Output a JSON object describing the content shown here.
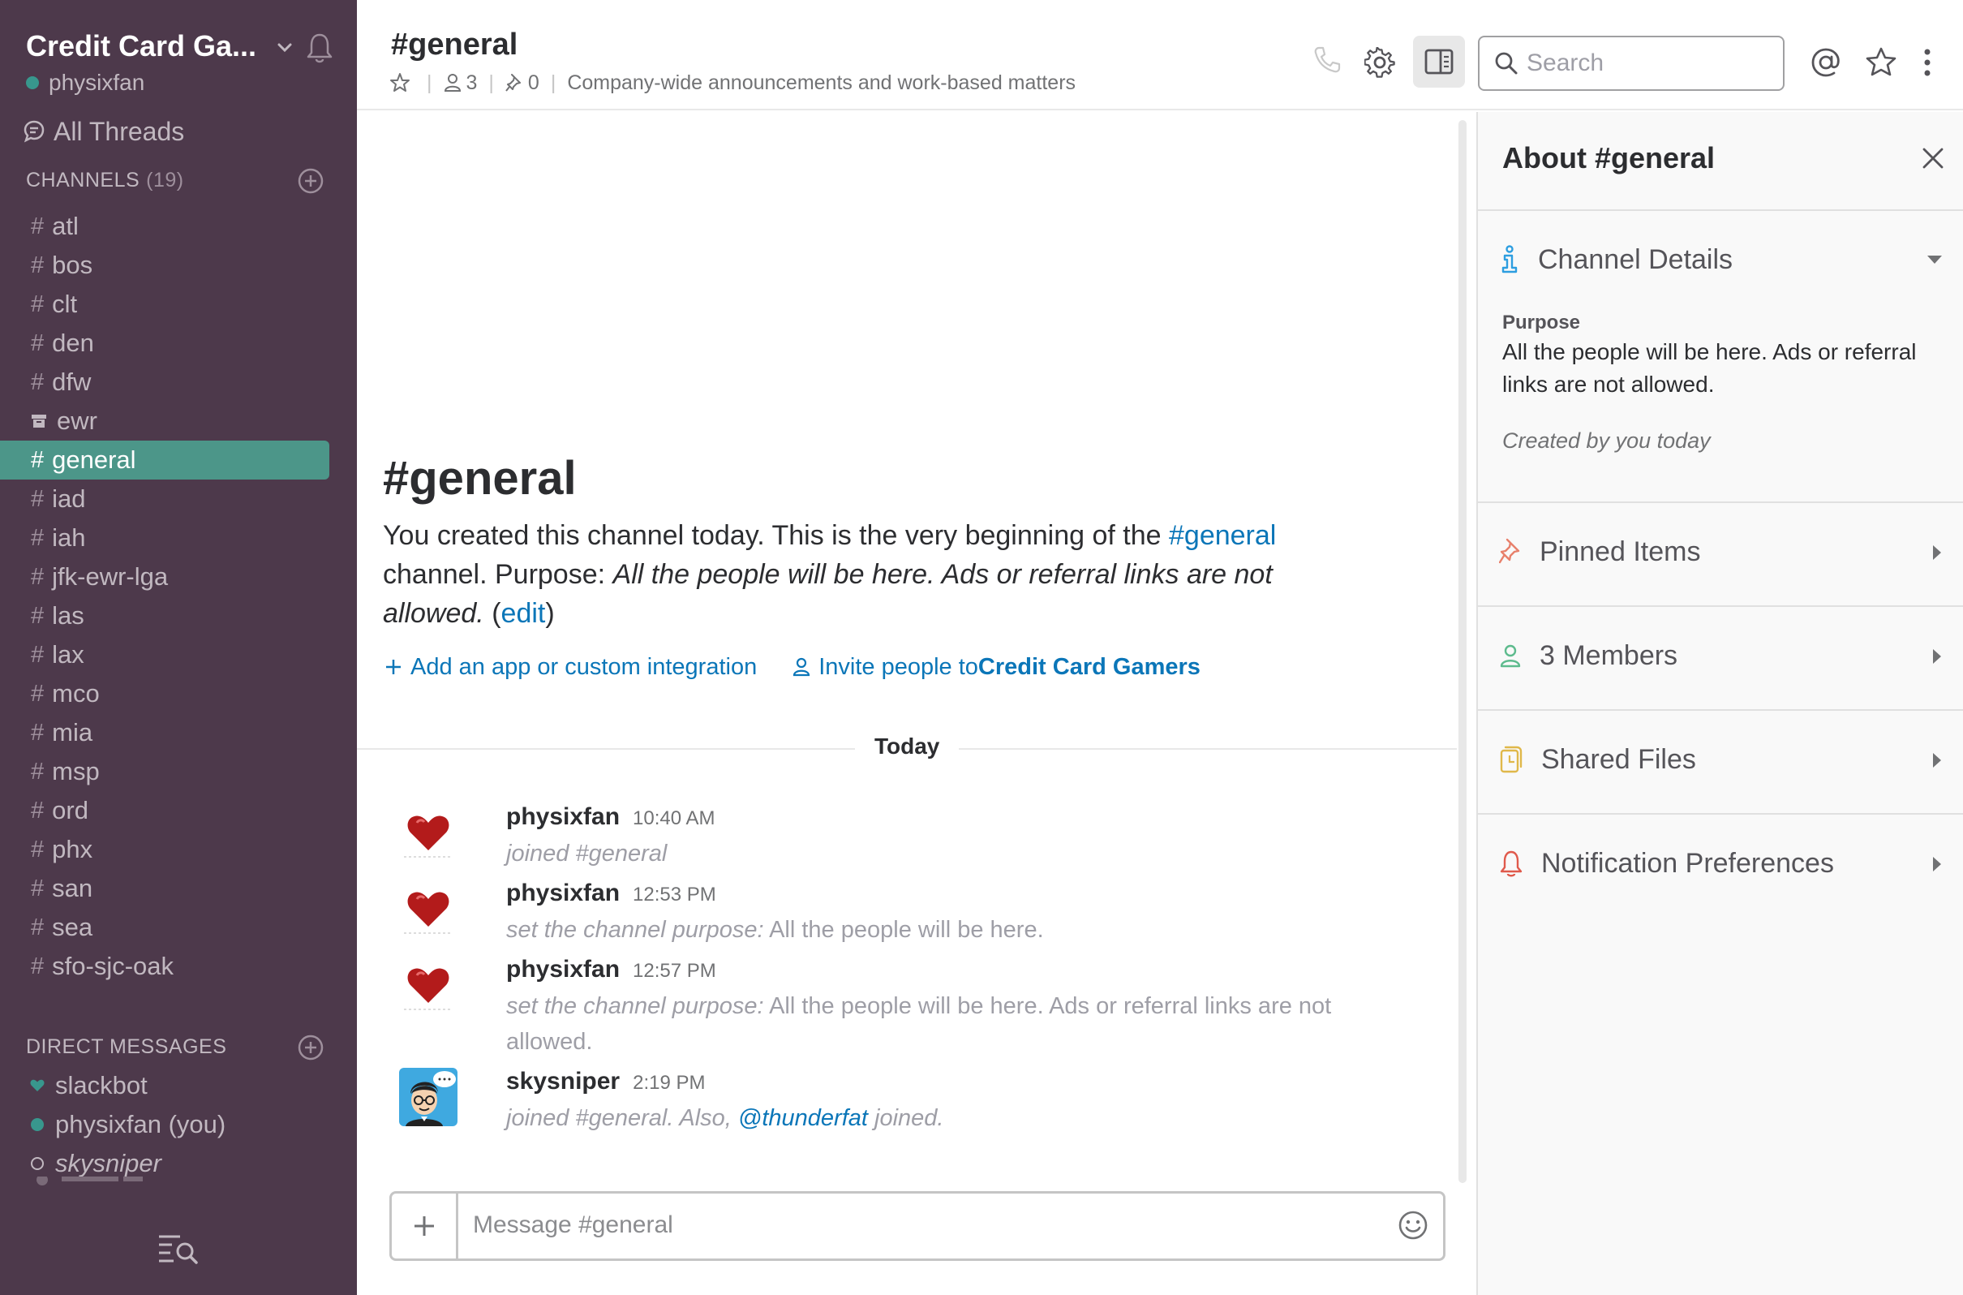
{
  "sidebar": {
    "team_name": "Credit Card Ga...",
    "user_name": "physixfan",
    "all_threads": "All Threads",
    "channels_header": "CHANNELS",
    "channels_count": "(19)",
    "channels": [
      {
        "name": "atl"
      },
      {
        "name": "bos"
      },
      {
        "name": "clt"
      },
      {
        "name": "den"
      },
      {
        "name": "dfw"
      },
      {
        "name": "ewr"
      },
      {
        "name": "general"
      },
      {
        "name": "iad"
      },
      {
        "name": "iah"
      },
      {
        "name": "jfk-ewr-lga"
      },
      {
        "name": "las"
      },
      {
        "name": "lax"
      },
      {
        "name": "mco"
      },
      {
        "name": "mia"
      },
      {
        "name": "msp"
      },
      {
        "name": "ord"
      },
      {
        "name": "phx"
      },
      {
        "name": "san"
      },
      {
        "name": "sea"
      },
      {
        "name": "sfo-sjc-oak"
      }
    ],
    "dm_header": "DIRECT MESSAGES",
    "dms": [
      {
        "name": "slackbot"
      },
      {
        "name": "physixfan (you)"
      },
      {
        "name": "skysniper"
      }
    ]
  },
  "header": {
    "channel_title": "#general",
    "members_count": "3",
    "pins_count": "0",
    "topic": "Company-wide announcements and work-based matters",
    "search_placeholder": "Search"
  },
  "intro": {
    "title": "#general",
    "text_1": "You created this channel today. This is the very beginning of the ",
    "channel_link": "#general",
    "text_2": " channel. Purpose: ",
    "purpose": "All the people will be here. Ads or referral links are not allowed.",
    "edit_open": " (",
    "edit_link": "edit",
    "edit_close": ")",
    "add_app": "Add an app or custom integration",
    "invite_prefix": "Invite people to ",
    "invite_team": "Credit Card Gamers"
  },
  "day_divider": "Today",
  "messages": [
    {
      "author": "physixfan",
      "time": "10:40 AM",
      "prefix": "joined #general",
      "text": ""
    },
    {
      "author": "physixfan",
      "time": "12:53 PM",
      "prefix": "set the channel purpose:",
      "text": " All the people will be here."
    },
    {
      "author": "physixfan",
      "time": "12:57 PM",
      "prefix": "set the channel purpose:",
      "text": " All the people will be here. Ads or referral links are not allowed."
    },
    {
      "author": "skysniper",
      "time": "2:19 PM",
      "prefix": "joined #general. Also, ",
      "mention": "@thunderfat",
      "suffix": " joined."
    }
  ],
  "composer": {
    "placeholder": "Message #general"
  },
  "panel": {
    "title": "About #general",
    "channel_details": "Channel Details",
    "purpose_label": "Purpose",
    "purpose_text": "All the people will be here. Ads or referral links are not allowed.",
    "created_by": "Created by you today",
    "pinned_items": "Pinned Items",
    "members": "3 Members",
    "shared_files": "Shared Files",
    "notification_prefs": "Notification Preferences"
  },
  "colors": {
    "sidebar_bg": "#4d394b",
    "active_channel": "#4c9689",
    "presence_green": "#38978d",
    "link_blue": "#0b76b8"
  }
}
